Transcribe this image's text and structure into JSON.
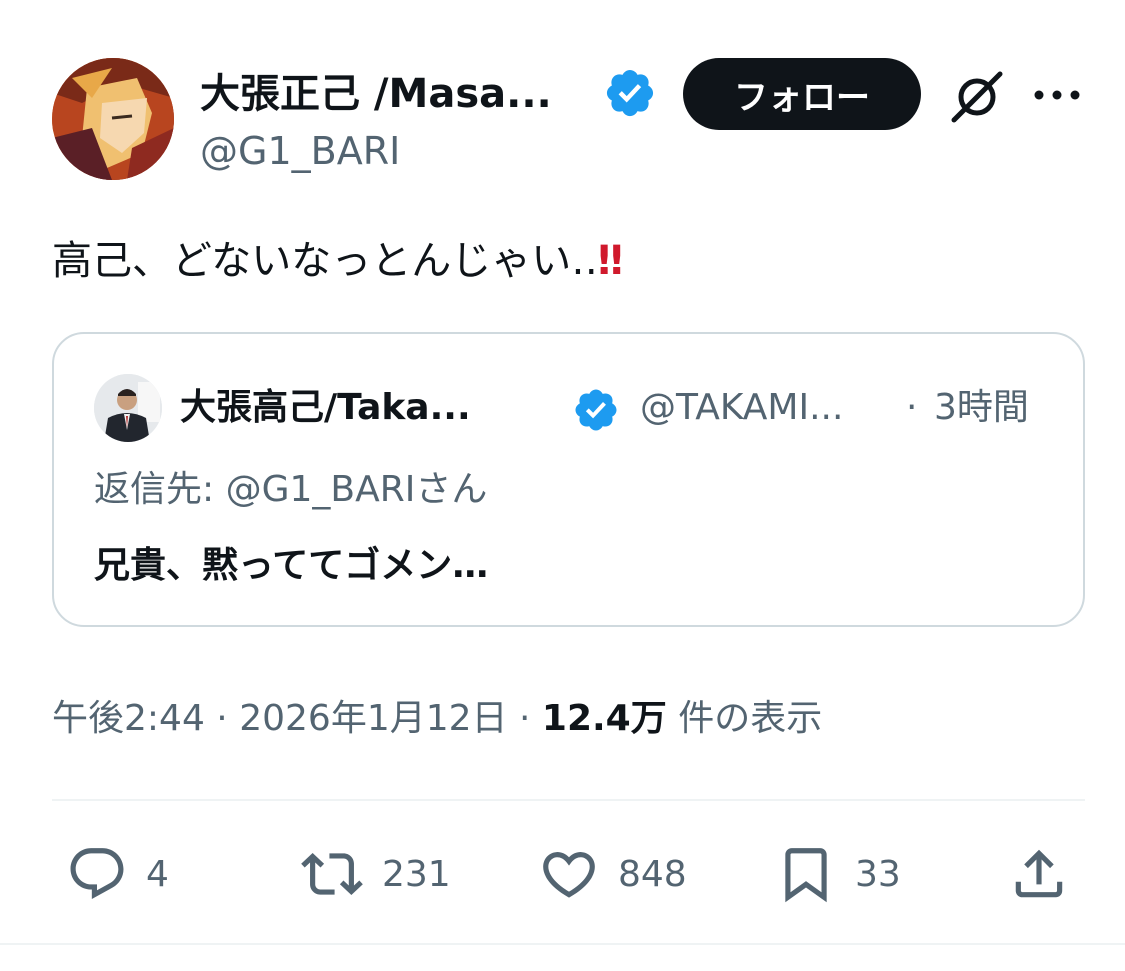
{
  "author": {
    "display_name": "大張正己 /Masa...",
    "handle": "@G1_BARI",
    "verified_icon": "verified-badge",
    "avatar_icon": "anime-character-avatar"
  },
  "header": {
    "follow_label": "フォロー",
    "grok_icon": "grok-icon",
    "more_icon": "more-icon"
  },
  "tweet": {
    "text": "高己、どないなっとんじゃい‥",
    "emoji": "‼"
  },
  "quote": {
    "display_name": "大張高己/Taka...",
    "handle": "@TAKAMI...",
    "separator": "·",
    "time": "3時間",
    "reply_to": "返信先: @G1_BARIさん",
    "text": "兄貴、黙っててゴメン…"
  },
  "meta": {
    "time": "午後2:44",
    "sep1": "·",
    "date": "2026年1月12日",
    "sep2": "·",
    "views_count": "12.4万",
    "views_label": "件の表示"
  },
  "actions": {
    "replies": "4",
    "reposts": "231",
    "likes": "848",
    "bookmarks": "33"
  },
  "colors": {
    "text": "#0f1419",
    "secondary": "#536471",
    "verified": "#1d9bf0",
    "border": "#cfd9de",
    "emoji_red": "#d0192c"
  }
}
